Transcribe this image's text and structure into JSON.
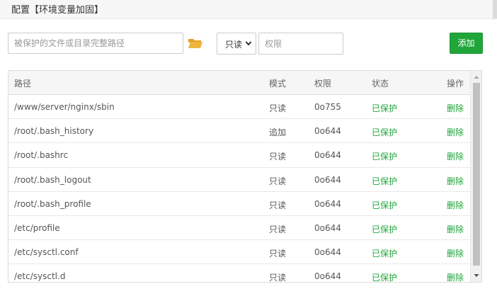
{
  "dialog": {
    "title": "配置【环境变量加固】"
  },
  "form": {
    "path_placeholder": "被保护的文件或目录完整路径",
    "path_value": "",
    "mode_selected": "只读",
    "perm_placeholder": "权限",
    "perm_value": "",
    "add_label": "添加"
  },
  "table": {
    "headers": {
      "path": "路径",
      "mode": "模式",
      "perm": "权限",
      "status": "状态",
      "op": "操作"
    },
    "rows": [
      {
        "path": "/www/server/nginx/sbin",
        "mode": "只读",
        "perm": "0o755",
        "status": "已保护",
        "op": "删除"
      },
      {
        "path": "/root/.bash_history",
        "mode": "追加",
        "perm": "0o644",
        "status": "已保护",
        "op": "删除"
      },
      {
        "path": "/root/.bashrc",
        "mode": "只读",
        "perm": "0o644",
        "status": "已保护",
        "op": "删除"
      },
      {
        "path": "/root/.bash_logout",
        "mode": "只读",
        "perm": "0o644",
        "status": "已保护",
        "op": "删除"
      },
      {
        "path": "/root/.bash_profile",
        "mode": "只读",
        "perm": "0o644",
        "status": "已保护",
        "op": "删除"
      },
      {
        "path": "/etc/profile",
        "mode": "只读",
        "perm": "0o644",
        "status": "已保护",
        "op": "删除"
      },
      {
        "path": "/etc/sysctl.conf",
        "mode": "只读",
        "perm": "0o644",
        "status": "已保护",
        "op": "删除"
      },
      {
        "path": "/etc/sysctl.d",
        "mode": "只读",
        "perm": "0o644",
        "status": "已保护",
        "op": "删除"
      }
    ]
  },
  "icons": {
    "folder": "folder-open-icon",
    "select_arrow": "chevron-down-icon",
    "scroll_up": "scroll-up-arrow-icon",
    "scroll_down": "scroll-down-arrow-icon"
  },
  "colors": {
    "accent_green": "#20a53a",
    "folder_yellow": "#f0b43c"
  }
}
